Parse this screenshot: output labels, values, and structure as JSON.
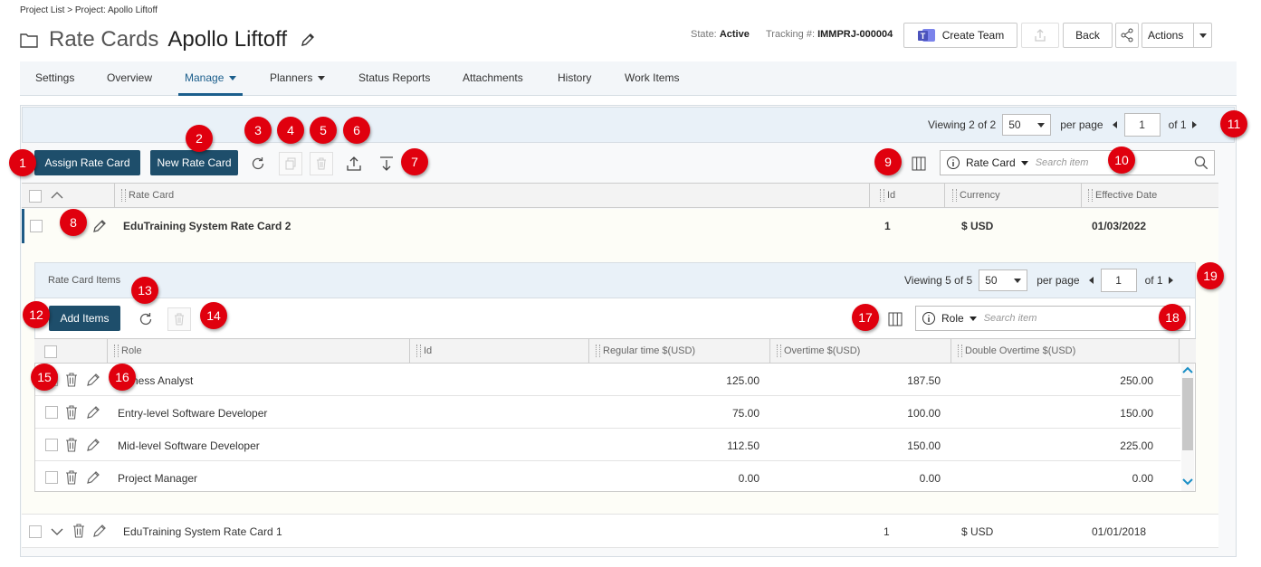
{
  "breadcrumb": "Project List > Project: Apollo Liftoff",
  "header": {
    "section": "Rate Cards",
    "project": "Apollo Liftoff"
  },
  "meta": {
    "state_label": "State:",
    "state_value": "Active",
    "tracking_label": "Tracking #:",
    "tracking_value": "IMMPRJ-000004"
  },
  "buttons": {
    "create_team": "Create Team",
    "back": "Back",
    "actions": "Actions"
  },
  "nav": [
    "Settings",
    "Overview",
    "Manage",
    "Planners",
    "Status Reports",
    "Attachments",
    "History",
    "Work Items"
  ],
  "outer_pager": {
    "viewing": "Viewing",
    "count": "2 of 2",
    "per_page_value": "50",
    "per_page": "per page",
    "page": "1",
    "of": "of 1"
  },
  "toolbar": {
    "assign": "Assign Rate Card",
    "new": "New Rate Card",
    "filter_field": "Rate Card",
    "search_placeholder": "Search item"
  },
  "rate_card_columns": [
    "Rate Card",
    "Id",
    "Currency",
    "Effective Date"
  ],
  "rate_cards": [
    {
      "name": "EduTraining System Rate Card 2",
      "id": "1",
      "currency": "$ USD",
      "date": "01/03/2022"
    },
    {
      "name": "EduTraining System Rate Card 1",
      "id": "1",
      "currency": "$ USD",
      "date": "01/01/2018"
    }
  ],
  "inner": {
    "title": "Rate Card Items",
    "pager": {
      "viewing": "Viewing",
      "count": "5 of 5",
      "per_page_value": "50",
      "per_page": "per page",
      "page": "1",
      "of": "of 1"
    },
    "add_items": "Add Items",
    "filter_field": "Role",
    "search_placeholder": "Search item",
    "columns": [
      "Role",
      "Id",
      "Regular time $(USD)",
      "Overtime $(USD)",
      "Double Overtime $(USD)"
    ],
    "rows": [
      {
        "role": "ness Analyst",
        "regular": "125.00",
        "overtime": "187.50",
        "double": "250.00"
      },
      {
        "role": "Entry-level Software Developer",
        "regular": "75.00",
        "overtime": "100.00",
        "double": "150.00"
      },
      {
        "role": "Mid-level Software Developer",
        "regular": "112.50",
        "overtime": "150.00",
        "double": "225.00"
      },
      {
        "role": "Project Manager",
        "regular": "0.00",
        "overtime": "0.00",
        "double": "0.00"
      }
    ]
  },
  "badges": [
    "1",
    "2",
    "3",
    "4",
    "5",
    "6",
    "7",
    "8",
    "9",
    "10",
    "11",
    "12",
    "13",
    "14",
    "15",
    "16",
    "17",
    "18",
    "19"
  ],
  "colors": {
    "primary_button": "#1e4e6b",
    "active_tab": "#1b5e8c",
    "badge": "#e0000e",
    "pager_bg": "#e9f1f8"
  }
}
